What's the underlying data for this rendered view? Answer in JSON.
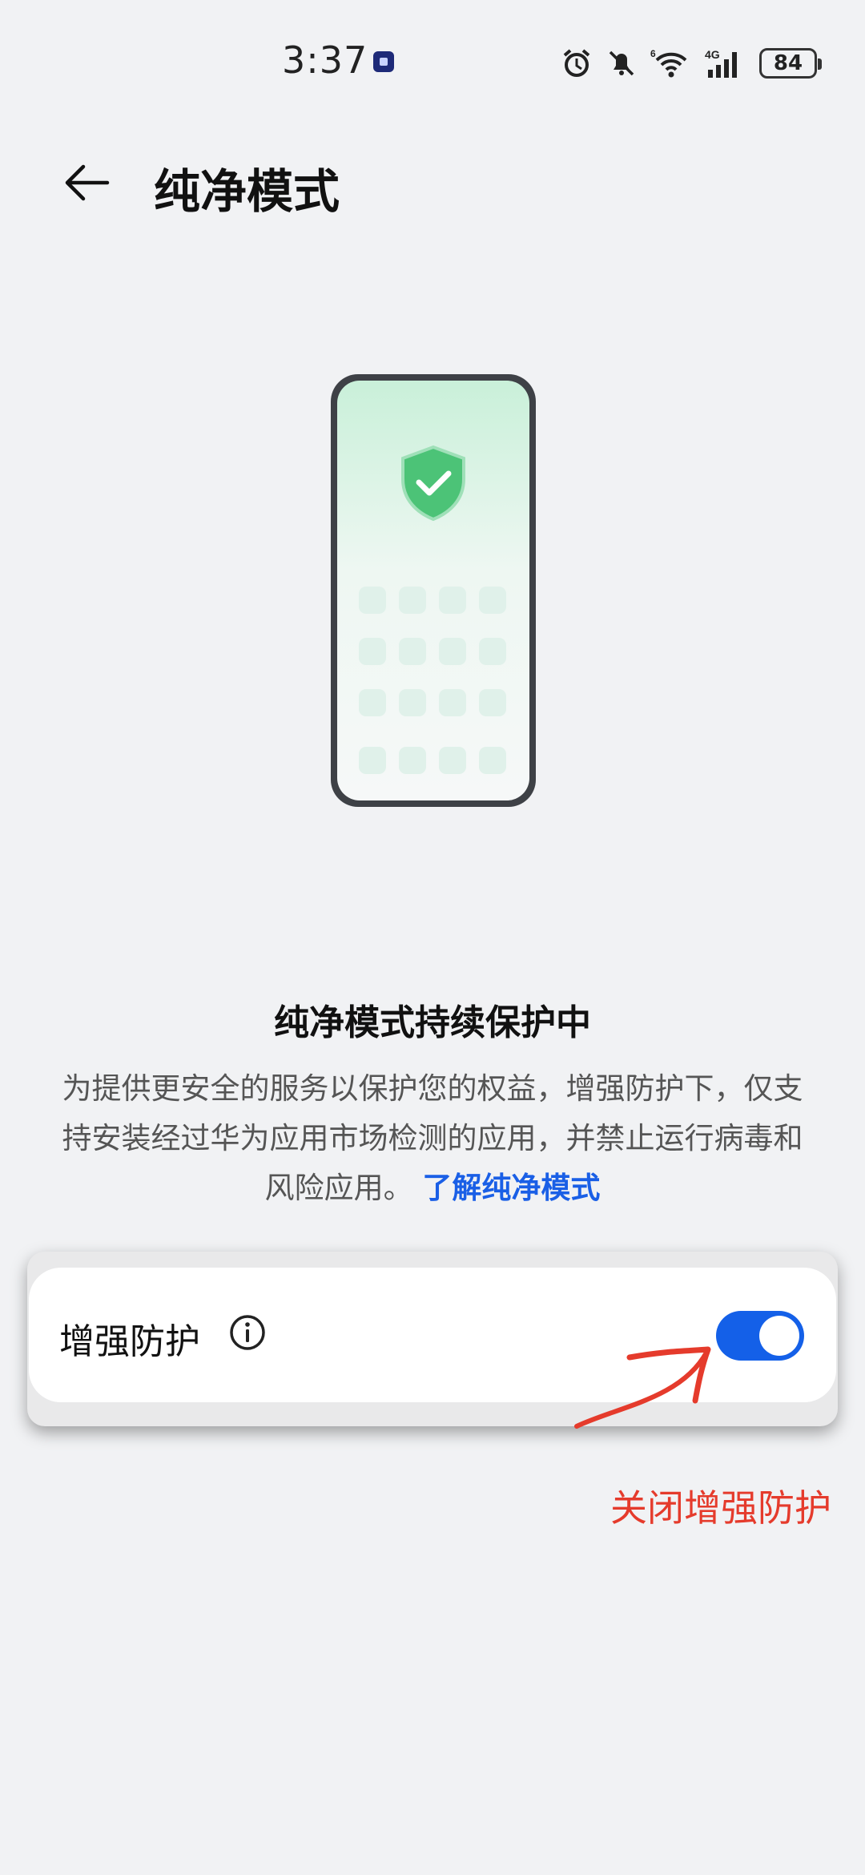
{
  "status_bar": {
    "time": "3:37",
    "battery": "84",
    "network_label": "4G",
    "wifi_label": "6"
  },
  "header": {
    "title": "纯净模式",
    "back_icon": "arrow-left-icon"
  },
  "illustration": {
    "icon": "shield-check-icon",
    "accent_color": "#4cc377"
  },
  "status": {
    "title": "纯净模式持续保护中",
    "description": "为提供更安全的服务以保护您的权益，增强防护下，仅支持安装经过华为应用市场检测的应用，并禁止运行病毒和风险应用。",
    "link": "了解纯净模式",
    "link_color": "#1a5fe6"
  },
  "setting": {
    "label": "增强防护",
    "info_icon": "info-icon",
    "toggle_on": true,
    "toggle_color": "#1460e8"
  },
  "annotation": {
    "text": "关闭增强防护",
    "color": "#e53b2c"
  }
}
